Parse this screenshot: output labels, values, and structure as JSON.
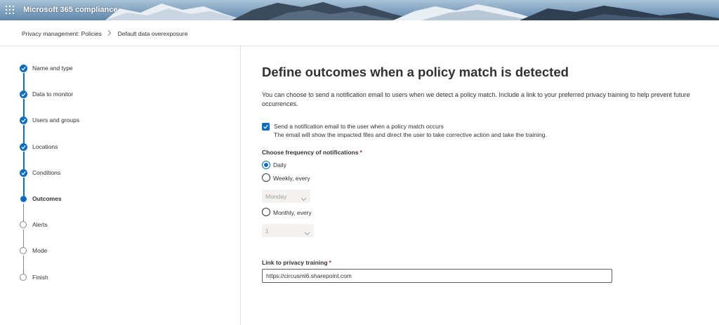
{
  "header": {
    "app_title": "Microsoft 365 compliance",
    "waffle_icon": "waffle-icon",
    "colors": {
      "sky": "#7ea6c8",
      "mountain_dark": "#3b4a5c",
      "snow": "#e8eef4"
    }
  },
  "breadcrumb": {
    "items": [
      "Privacy management: Policies",
      "Default data overexposure"
    ],
    "separator_icon": "chevron-right-icon"
  },
  "stepper": {
    "steps": [
      {
        "label": "Name and type",
        "state": "done"
      },
      {
        "label": "Data to monitor",
        "state": "done"
      },
      {
        "label": "Users and groups",
        "state": "done"
      },
      {
        "label": "Locations",
        "state": "done"
      },
      {
        "label": "Conditions",
        "state": "done"
      },
      {
        "label": "Outcomes",
        "state": "current"
      },
      {
        "label": "Alerts",
        "state": "todo"
      },
      {
        "label": "Mode",
        "state": "todo"
      },
      {
        "label": "Finish",
        "state": "todo"
      }
    ],
    "colors": {
      "active": "#0f6cbd",
      "inactive": "#8a8886"
    }
  },
  "main": {
    "title": "Define outcomes when a policy match is detected",
    "description": "You can choose to send a notification email to users when we detect a policy match. Include a link to your preferred privacy training to help prevent future occurrences.",
    "notify_checkbox": {
      "checked": true,
      "label": "Send a notification email to the user when a policy match occurs",
      "description": "The email will show the impacted files and direct the user to take corrective action and take the training."
    },
    "frequency": {
      "label": "Choose frequency of notifications",
      "required_mark": "*",
      "options": [
        {
          "label": "Daily",
          "checked": true
        },
        {
          "label": "Weekly, every",
          "checked": false
        },
        {
          "label": "Monthly, every",
          "checked": false
        }
      ],
      "weekly_dropdown": {
        "value": "Monday",
        "disabled": true
      },
      "monthly_dropdown": {
        "value": "1",
        "disabled": true
      }
    },
    "training_link": {
      "label": "Link to privacy training",
      "required_mark": "*",
      "value": "https://circusmi6.sharepoint.com"
    }
  }
}
